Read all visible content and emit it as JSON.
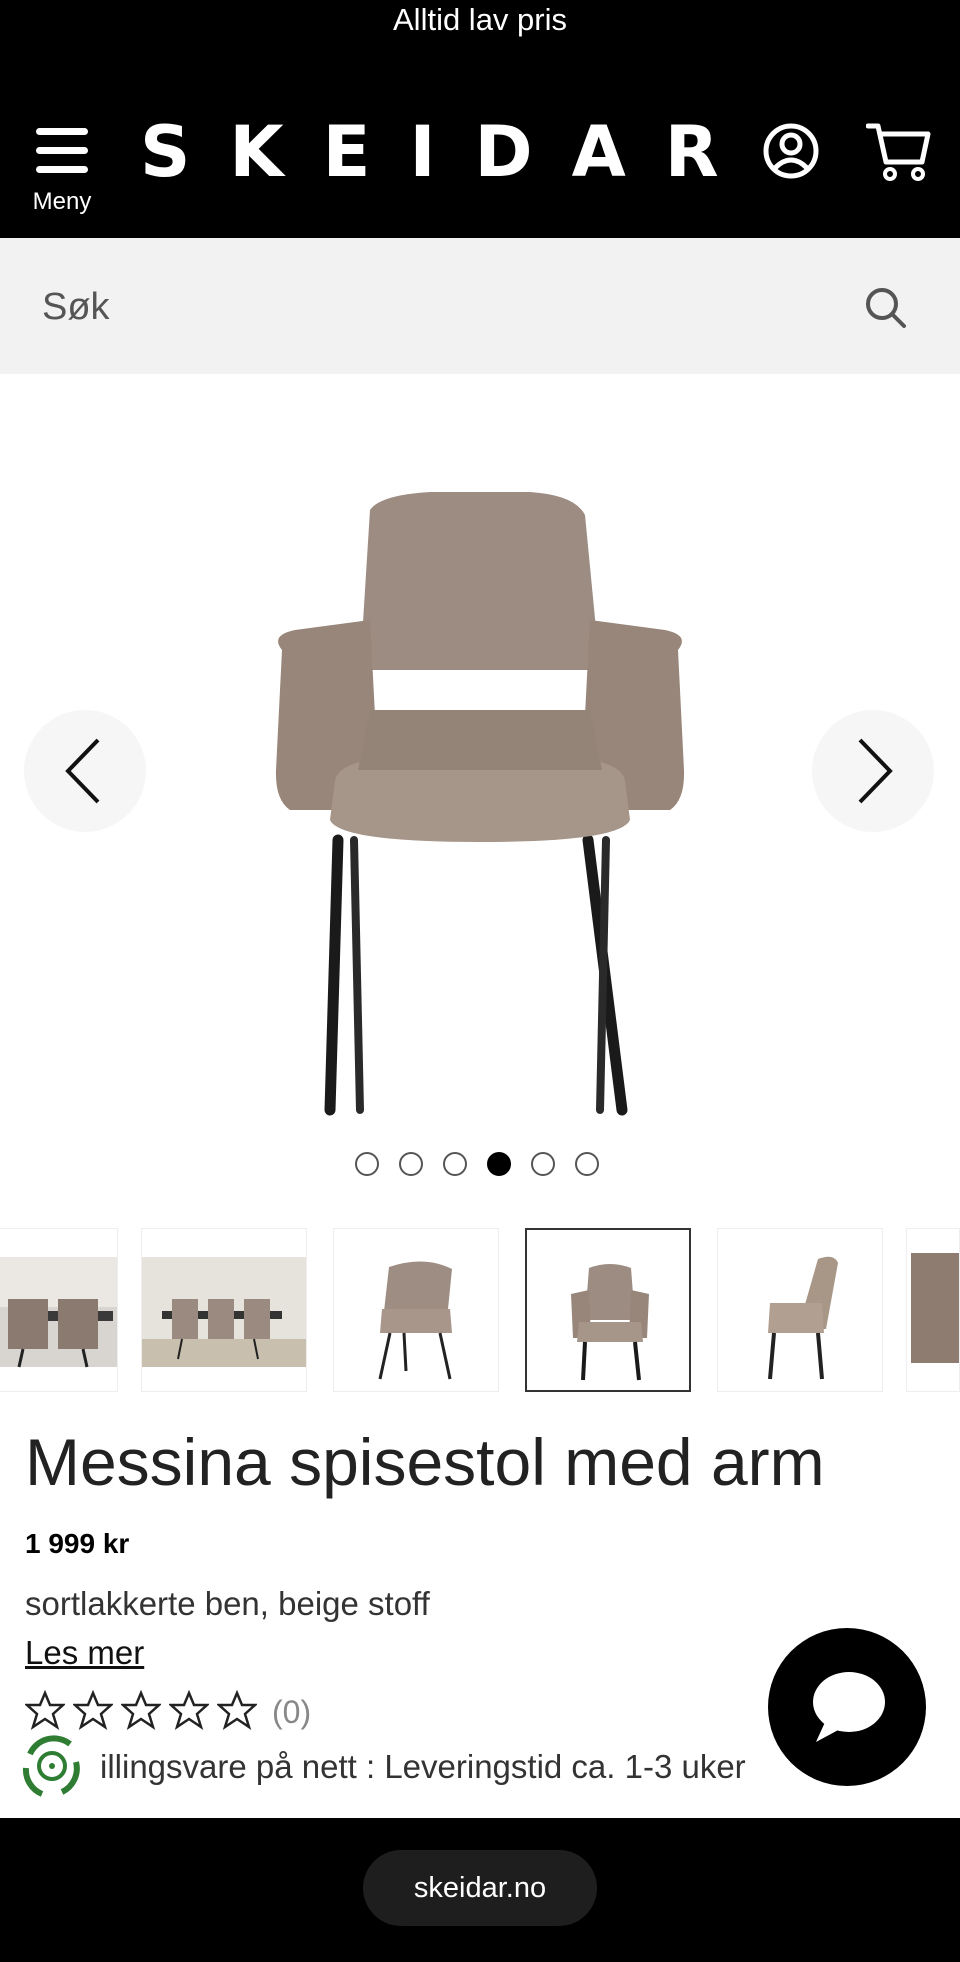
{
  "header": {
    "promo": "Alltid lav pris",
    "menu_label": "Meny",
    "logo": "SKEIDAR",
    "icons": {
      "account": "account-icon",
      "cart": "cart-icon",
      "menu": "hamburger-icon"
    }
  },
  "search": {
    "placeholder": "Søk",
    "icon": "search-icon"
  },
  "gallery": {
    "image_count": 6,
    "active_index": 4,
    "thumbnail_count": 6,
    "selected_thumbnail": 4
  },
  "product": {
    "title": "Messina spisestol med arm",
    "price": "1 999 kr",
    "subtitle": "sortlakkerte ben, beige stoff",
    "read_more": "Les mer",
    "rating": 0,
    "rating_max": 5,
    "review_count": "(0)",
    "delivery": "illingsvare på nett : Leveringstid ca. 1-3 uker"
  },
  "browser": {
    "url": "skeidar.no"
  },
  "colors": {
    "black": "#000000",
    "chair_fabric": "#9b8a80",
    "search_bg": "#f2f2f2",
    "delivery_green": "#2e7d32"
  }
}
